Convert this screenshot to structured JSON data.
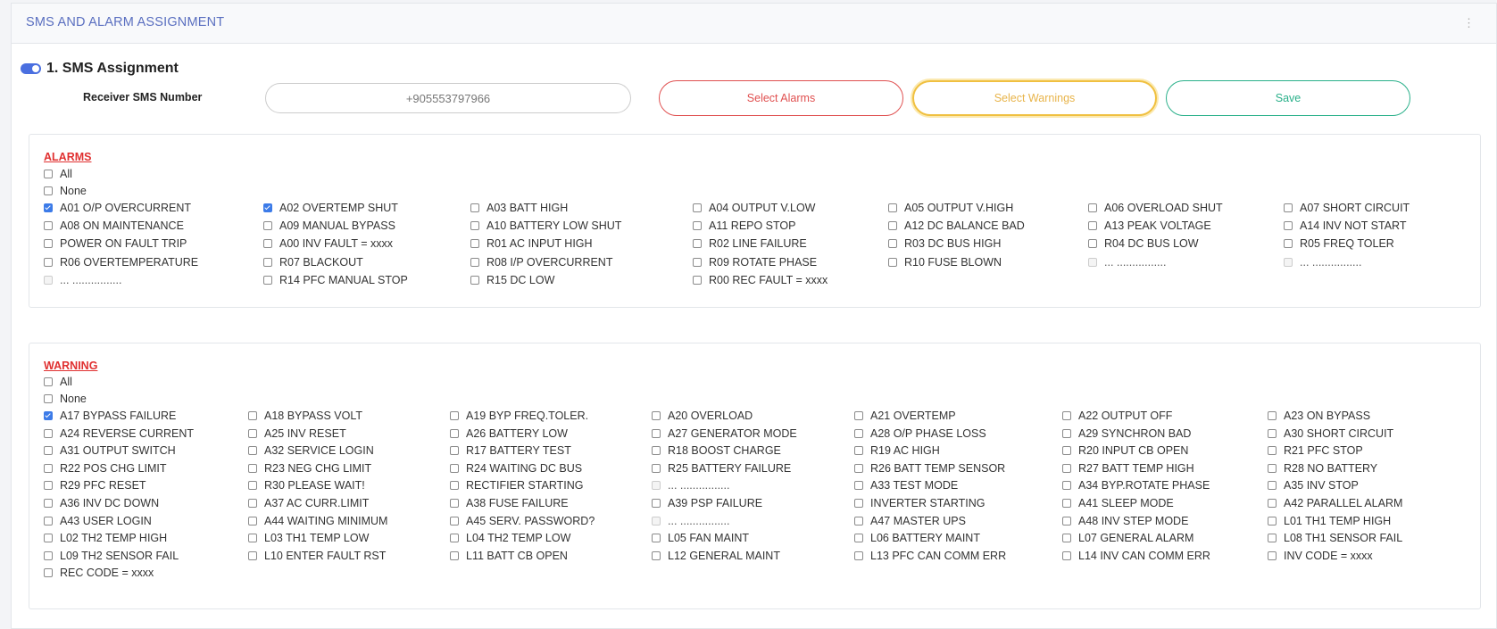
{
  "header": {
    "title": "SMS AND ALARM ASSIGNMENT",
    "menu_icon": "kebab-icon"
  },
  "sms": {
    "title": "1. SMS Assignment",
    "receiver_label": "Receiver SMS Number",
    "receiver_value": "+905553797966",
    "select_alarms": "Select Alarms",
    "select_warnings": "Select Warnings",
    "save": "Save"
  },
  "alarms": {
    "label": "ALARMS",
    "all": "All",
    "none": "None",
    "cols": [
      [
        {
          "t": "A01 O/P OVERCURRENT",
          "c": true
        },
        {
          "t": "A08 ON MAINTENANCE"
        },
        {
          "t": "POWER ON FAULT TRIP"
        },
        {
          "t": "R06 OVERTEMPERATURE"
        },
        {
          "t": "... ................",
          "d": true
        }
      ],
      [
        {
          "t": "A02 OVERTEMP SHUT",
          "c": true
        },
        {
          "t": "A09 MANUAL BYPASS"
        },
        {
          "t": "A00 INV FAULT = xxxx"
        },
        {
          "t": "R07 BLACKOUT"
        },
        {
          "t": "R14 PFC MANUAL STOP"
        }
      ],
      [
        {
          "t": "A03 BATT HIGH"
        },
        {
          "t": "A10 BATTERY LOW SHUT"
        },
        {
          "t": "R01 AC INPUT HIGH"
        },
        {
          "t": "R08 I/P OVERCURRENT"
        },
        {
          "t": "R15 DC LOW"
        }
      ],
      [
        {
          "t": "A04 OUTPUT V.LOW"
        },
        {
          "t": "A11 REPO STOP"
        },
        {
          "t": "R02 LINE FAILURE"
        },
        {
          "t": "R09 ROTATE PHASE"
        },
        {
          "t": "R00 REC FAULT = xxxx"
        }
      ],
      [
        {
          "t": "A05 OUTPUT V.HIGH"
        },
        {
          "t": "A12 DC BALANCE BAD"
        },
        {
          "t": "R03 DC BUS HIGH"
        },
        {
          "t": "R10 FUSE BLOWN"
        }
      ],
      [
        {
          "t": "A06 OVERLOAD SHUT"
        },
        {
          "t": "A13 PEAK VOLTAGE"
        },
        {
          "t": "R04 DC BUS LOW"
        },
        {
          "t": "... ................",
          "d": true
        }
      ],
      [
        {
          "t": "A07 SHORT CIRCUIT"
        },
        {
          "t": "A14 INV NOT START"
        },
        {
          "t": "R05 FREQ TOLER"
        },
        {
          "t": "... ................",
          "d": true
        }
      ]
    ]
  },
  "warnings": {
    "label": "WARNING",
    "all": "All",
    "none": "None",
    "cols": [
      [
        {
          "t": "A17 BYPASS FAILURE",
          "c": true
        },
        {
          "t": "A24 REVERSE CURRENT"
        },
        {
          "t": "A31 OUTPUT SWITCH"
        },
        {
          "t": "R22 POS CHG LIMIT"
        },
        {
          "t": "R29 PFC RESET"
        },
        {
          "t": "A36 INV DC DOWN"
        },
        {
          "t": "A43 USER LOGIN"
        },
        {
          "t": "L02 TH2 TEMP HIGH"
        },
        {
          "t": "L09 TH2 SENSOR FAIL"
        },
        {
          "t": "REC CODE = xxxx"
        }
      ],
      [
        {
          "t": "A18 BYPASS VOLT"
        },
        {
          "t": "A25 INV RESET"
        },
        {
          "t": "A32 SERVICE LOGIN"
        },
        {
          "t": "R23 NEG CHG LIMIT"
        },
        {
          "t": "R30 PLEASE WAIT!"
        },
        {
          "t": "A37 AC CURR.LIMIT"
        },
        {
          "t": "A44 WAITING MINIMUM"
        },
        {
          "t": "L03 TH1 TEMP LOW"
        },
        {
          "t": "L10 ENTER FAULT RST"
        }
      ],
      [
        {
          "t": "A19 BYP FREQ.TOLER."
        },
        {
          "t": "A26 BATTERY LOW"
        },
        {
          "t": "R17 BATTERY TEST"
        },
        {
          "t": "R24 WAITING DC BUS"
        },
        {
          "t": "RECTIFIER STARTING"
        },
        {
          "t": "A38 FUSE FAILURE"
        },
        {
          "t": "A45 SERV. PASSWORD?"
        },
        {
          "t": "L04 TH2 TEMP LOW"
        },
        {
          "t": "L11 BATT CB OPEN"
        }
      ],
      [
        {
          "t": "A20 OVERLOAD"
        },
        {
          "t": "A27 GENERATOR MODE"
        },
        {
          "t": "R18 BOOST CHARGE"
        },
        {
          "t": "R25 BATTERY FAILURE"
        },
        {
          "t": "... ................",
          "d": true
        },
        {
          "t": "A39 PSP FAILURE"
        },
        {
          "t": "... ................",
          "d": true
        },
        {
          "t": "L05 FAN MAINT"
        },
        {
          "t": "L12 GENERAL MAINT"
        }
      ],
      [
        {
          "t": "A21 OVERTEMP"
        },
        {
          "t": "A28 O/P PHASE LOSS"
        },
        {
          "t": "R19 AC HIGH"
        },
        {
          "t": "R26 BATT TEMP SENSOR"
        },
        {
          "t": "A33 TEST MODE"
        },
        {
          "t": "INVERTER STARTING"
        },
        {
          "t": "A47 MASTER UPS"
        },
        {
          "t": "L06 BATTERY MAINT"
        },
        {
          "t": "L13 PFC CAN COMM ERR"
        }
      ],
      [
        {
          "t": "A22 OUTPUT OFF"
        },
        {
          "t": "A29 SYNCHRON BAD"
        },
        {
          "t": "R20 INPUT CB OPEN"
        },
        {
          "t": "R27 BATT TEMP HIGH"
        },
        {
          "t": "A34 BYP.ROTATE PHASE"
        },
        {
          "t": "A41 SLEEP MODE"
        },
        {
          "t": "A48 INV STEP MODE"
        },
        {
          "t": "L07 GENERAL ALARM"
        },
        {
          "t": "L14 INV CAN COMM ERR"
        }
      ],
      [
        {
          "t": "A23 ON BYPASS"
        },
        {
          "t": "A30 SHORT CIRCUIT"
        },
        {
          "t": "R21 PFC STOP"
        },
        {
          "t": "R28 NO BATTERY"
        },
        {
          "t": "A35 INV STOP"
        },
        {
          "t": "A42 PARALLEL ALARM"
        },
        {
          "t": "L01 TH1 TEMP HIGH"
        },
        {
          "t": "L08 TH1 SENSOR FAIL"
        },
        {
          "t": "INV CODE = xxxx"
        }
      ]
    ]
  }
}
